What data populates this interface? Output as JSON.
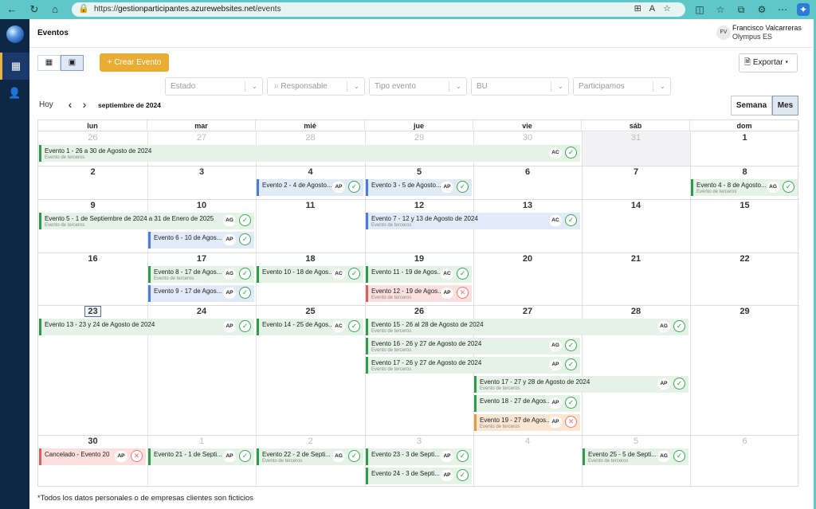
{
  "browser": {
    "url_prefix": "https://",
    "url_domain": "gestionparticipantes.azurewebsites.net",
    "url_path": "/events"
  },
  "header": {
    "title": "Eventos",
    "user_initials": "FV",
    "user_name": "Francisco Valcarreras",
    "user_org": "Olympus ES"
  },
  "toolbar": {
    "create_label": "+  Crear Evento",
    "export_label": "Exportar"
  },
  "filters": {
    "estado": "Estado",
    "responsable": "Responsable",
    "tipo": "Tipo evento",
    "bu": "BU",
    "participamos": "Participamos"
  },
  "nav": {
    "today": "Hoy",
    "month": "septiembre de 2024",
    "week_label": "Semana",
    "month_label": "Mes"
  },
  "weekdays": [
    "lun",
    "mar",
    "mié",
    "jue",
    "vie",
    "sáb",
    "dom"
  ],
  "weeks": [
    [
      "26",
      "27",
      "28",
      "29",
      "30",
      "31",
      "1"
    ],
    [
      "2",
      "3",
      "4",
      "5",
      "6",
      "7",
      "8"
    ],
    [
      "9",
      "10",
      "11",
      "12",
      "13",
      "14",
      "15"
    ],
    [
      "16",
      "17",
      "18",
      "19",
      "20",
      "21",
      "22"
    ],
    [
      "23",
      "24",
      "25",
      "26",
      "27",
      "28",
      "29"
    ],
    [
      "30",
      "1",
      "2",
      "3",
      "4",
      "5",
      "6"
    ]
  ],
  "events": [
    {
      "title": "Evento 1 - 26 a 30 de Agosto de 2024",
      "sub": "Evento de terceros",
      "badge": "AC",
      "status": "ok",
      "color": "green"
    },
    {
      "title": "Evento 2 - 4 de Agosto...",
      "sub": "",
      "badge": "AP",
      "status": "ok",
      "color": "blue"
    },
    {
      "title": "Evento 3 - 5 de Agosto...",
      "sub": "",
      "badge": "AP",
      "status": "ok",
      "color": "blue"
    },
    {
      "title": "Evento 4 - 8 de Agosto...",
      "sub": "Evento de terceros",
      "badge": "AG",
      "status": "ok",
      "color": "green"
    },
    {
      "title": "Evento 5 - 1 de Septiembre de 2024 a 31 de Enero de 2025",
      "sub": "Evento de terceros",
      "badge": "AG",
      "status": "ok",
      "color": "green"
    },
    {
      "title": "Evento 7 - 12 y 13 de Agosto de 2024",
      "sub": "Evento de terceros",
      "badge": "AC",
      "status": "ok",
      "color": "blue"
    },
    {
      "title": "Evento 6 - 10 de Agos...",
      "sub": "",
      "badge": "AP",
      "status": "ok",
      "color": "blue"
    },
    {
      "title": "Evento 8 - 17 de Agos...",
      "sub": "Evento de terceros",
      "badge": "AG",
      "status": "ok",
      "color": "green"
    },
    {
      "title": "Evento 10 - 18 de Agos...",
      "sub": "",
      "badge": "AC",
      "status": "ok",
      "color": "green"
    },
    {
      "title": "Evento 11 - 19 de Agos...",
      "sub": "",
      "badge": "AC",
      "status": "ok",
      "color": "green"
    },
    {
      "title": "Evento 9 - 17 de Agos...",
      "sub": "",
      "badge": "AP",
      "status": "ok",
      "color": "blue"
    },
    {
      "title": "Evento 12 - 19 de Agos...",
      "sub": "Evento de terceros",
      "badge": "AP",
      "status": "bad",
      "color": "red"
    },
    {
      "title": "Evento 13 - 23 y 24 de Agosto de 2024",
      "sub": "",
      "badge": "AP",
      "status": "ok",
      "color": "green"
    },
    {
      "title": "Evento 14 - 25 de Agos...",
      "sub": "",
      "badge": "AC",
      "status": "ok",
      "color": "green"
    },
    {
      "title": "Evento 15 - 26 al 28 de Agosto de 2024",
      "sub": "Evento de terceros",
      "badge": "AG",
      "status": "ok",
      "color": "green"
    },
    {
      "title": "Evento 16 - 26 y 27 de Agosto de 2024",
      "sub": "Evento de terceros",
      "badge": "AG",
      "status": "ok",
      "color": "green"
    },
    {
      "title": "Evento 17 - 26 y 27 de Agosto de 2024",
      "sub": "Evento de terceros",
      "badge": "AP",
      "status": "ok",
      "color": "green"
    },
    {
      "title": "Evento 17 - 27 y 28 de Agosto de 2024",
      "sub": "Evento de terceros",
      "badge": "AP",
      "status": "ok",
      "color": "green"
    },
    {
      "title": "Evento 18 - 27 de Agos...",
      "sub": "",
      "badge": "AP",
      "status": "ok",
      "color": "green"
    },
    {
      "title": "Evento 19 - 27 de Agos...",
      "sub": "Evento de terceros",
      "badge": "AP",
      "status": "bad",
      "color": "orange"
    },
    {
      "title": "Cancelado - Evento 20",
      "sub": "",
      "badge": "AP",
      "status": "bad",
      "color": "red"
    },
    {
      "title": "Evento 21 - 1 de Septi...",
      "sub": "",
      "badge": "AP",
      "status": "ok",
      "color": "green"
    },
    {
      "title": "Evento 22 - 2 de Septi...",
      "sub": "Evento de terceros",
      "badge": "AG",
      "status": "ok",
      "color": "green"
    },
    {
      "title": "Evento 23 - 3 de Septi...",
      "sub": "",
      "badge": "AP",
      "status": "ok",
      "color": "green"
    },
    {
      "title": "Evento 24 - 3 de Septi...",
      "sub": "",
      "badge": "AP",
      "status": "ok",
      "color": "green"
    },
    {
      "title": "Evento 25 - 5 de Septi...",
      "sub": "Evento de terceros",
      "badge": "AG",
      "status": "ok",
      "color": "green"
    }
  ],
  "footer": {
    "note": "*Todos los datos personales o de empresas clientes son ficticios"
  }
}
